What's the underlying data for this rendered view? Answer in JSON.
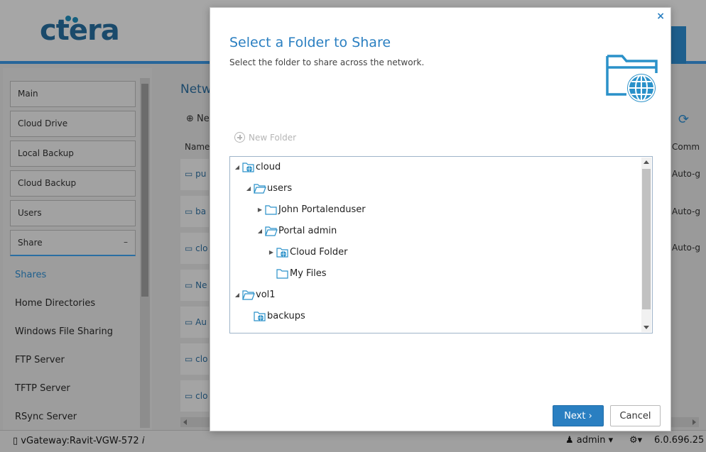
{
  "app": {
    "logo_text": "ctera",
    "sidebar": {
      "items": [
        {
          "label": "Main"
        },
        {
          "label": "Cloud Drive"
        },
        {
          "label": "Local Backup"
        },
        {
          "label": "Cloud Backup"
        },
        {
          "label": "Users"
        },
        {
          "label": "Share",
          "toggle": "–"
        }
      ],
      "subitems": [
        {
          "label": "Shares"
        },
        {
          "label": "Home Directories"
        },
        {
          "label": "Windows File Sharing"
        },
        {
          "label": "FTP Server"
        },
        {
          "label": "TFTP Server"
        },
        {
          "label": "RSync Server"
        }
      ]
    },
    "main": {
      "title": "Netw",
      "new_label": "Ne",
      "column_name": "Name",
      "column_comment": "Comm",
      "rows": [
        {
          "name": "pu",
          "comment": "Auto-g"
        },
        {
          "name": "ba",
          "comment": "Auto-g"
        },
        {
          "name": "clo",
          "comment": "Auto-g"
        },
        {
          "name": "Ne",
          "comment": ""
        },
        {
          "name": "Au",
          "comment": ""
        },
        {
          "name": "clo",
          "comment": ""
        },
        {
          "name": "clo",
          "comment": ""
        }
      ]
    },
    "status": {
      "gateway": "vGateway:Ravit-VGW-572",
      "user": "admin",
      "version": "6.0.696.25"
    }
  },
  "modal": {
    "close_glyph": "×",
    "title": "Select a Folder to Share",
    "subtitle": "Select the folder to share across the network.",
    "new_folder_label": "New Folder",
    "tree": [
      {
        "label": "cloud",
        "icon": "shared-folder-icon",
        "toggle": "expanded"
      },
      {
        "label": "users",
        "icon": "folder-open-icon",
        "toggle": "expanded"
      },
      {
        "label": "John Portalenduser",
        "icon": "folder-icon",
        "toggle": "collapsed"
      },
      {
        "label": "Portal admin",
        "icon": "folder-open-icon",
        "toggle": "expanded"
      },
      {
        "label": "Cloud Folder",
        "icon": "shared-folder-icon",
        "toggle": "collapsed"
      },
      {
        "label": "My Files",
        "icon": "folder-icon",
        "toggle": "none"
      },
      {
        "label": "vol1",
        "icon": "folder-open-icon",
        "toggle": "expanded"
      },
      {
        "label": "backups",
        "icon": "shared-folder-icon",
        "toggle": "none"
      }
    ],
    "next_label": "Next ›",
    "cancel_label": "Cancel"
  },
  "colors": {
    "accent": "#2a7fc1",
    "header_bar": "#27669a"
  }
}
